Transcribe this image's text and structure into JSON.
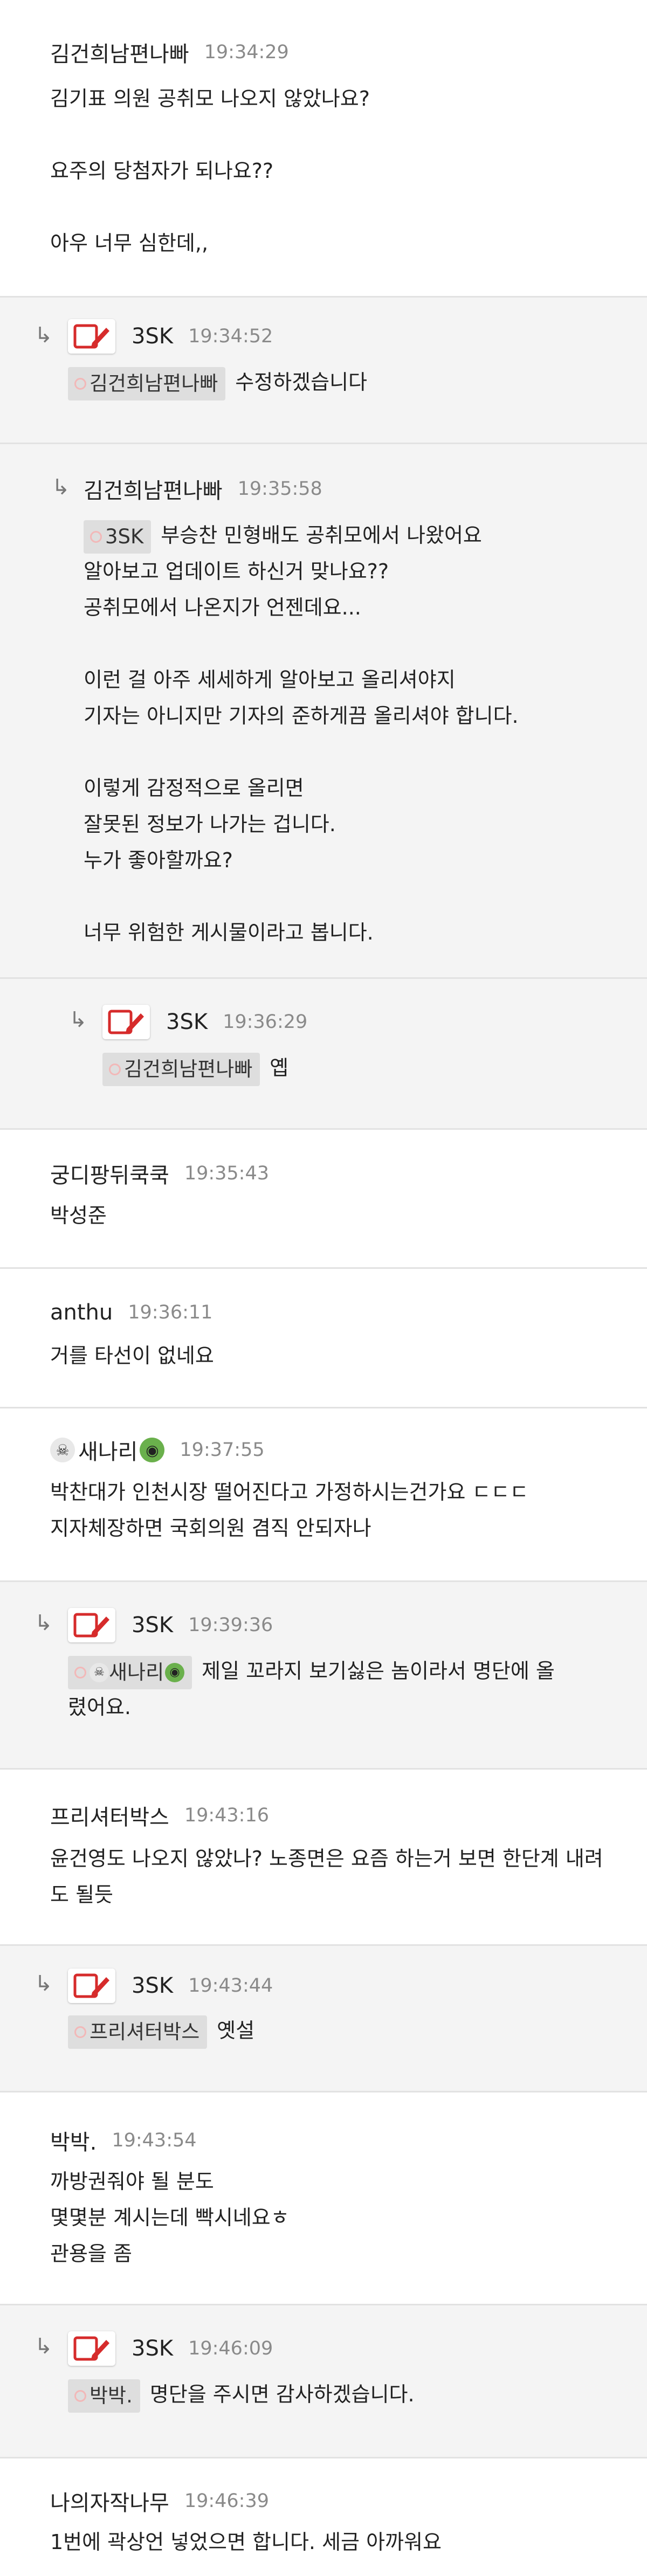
{
  "comments": [
    {
      "nick": "김건희남편나빠",
      "time": "19:34:29",
      "lines": [
        "김기표 의원 공취모 나오지 않았나요?",
        "",
        "요주의 당첨자가 되나요??",
        "",
        "아우 너무 심한데,,"
      ]
    },
    {
      "nick": "3SK",
      "time": "19:34:52",
      "mention": "김건희남편나빠",
      "text": "수정하겠습니다"
    },
    {
      "nick": "김건희남편나빠",
      "time": "19:35:58",
      "mention": "3SK",
      "lines": [
        "부승찬 민형배도 공취모에서 나왔어요",
        "알아보고 업데이트 하신거 맞나요??",
        "공취모에서 나온지가 언젠데요...",
        "",
        "이런 걸 아주 세세하게 알아보고 올리셔야지",
        "기자는 아니지만 기자의 준하게끔 올리셔야 합니다.",
        "",
        "이렇게 감정적으로 올리면",
        "잘못된 정보가 나가는 겁니다.",
        "누가 좋아할까요?",
        "",
        "너무 위험한 게시물이라고 봅니다."
      ]
    },
    {
      "nick": "3SK",
      "time": "19:36:29",
      "mention": "김건희남편나빠",
      "text": "옙"
    },
    {
      "nick": "궁디팡뒤쿡쿡",
      "time": "19:35:43",
      "lines": [
        "박성준"
      ]
    },
    {
      "nick": "anthu",
      "time": "19:36:11",
      "lines": [
        "거를 타선이 없네요"
      ]
    },
    {
      "nick": "새나리",
      "time": "19:37:55",
      "lines": [
        "박찬대가 인천시장 떨어진다고 가정하시는건가요 ㄷㄷㄷ",
        "지자체장하면 국회의원 겸직 안되자나"
      ]
    },
    {
      "nick": "3SK",
      "time": "19:39:36",
      "mention": "새나리",
      "text": "제일 꼬라지 보기싫은 놈이라서 명단에 올",
      "text2": "렸어요."
    },
    {
      "nick": "프리셔터박스",
      "time": "19:43:16",
      "lines": [
        "윤건영도 나오지 않았나? 노종면은 요즘 하는거 보면 한단계 내려",
        "도 될듯"
      ]
    },
    {
      "nick": "3SK",
      "time": "19:43:44",
      "mention": "프리셔터박스",
      "text": "옛설"
    },
    {
      "nick": "박박.",
      "time": "19:43:54",
      "lines": [
        "까방권줘야 될 분도",
        "몇몇분 계시는데 빡시네요ㅎ",
        "관용을 좀"
      ]
    },
    {
      "nick": "3SK",
      "time": "19:46:09",
      "mention": "박박.",
      "text": "명단을 주시면 감사하겠습니다."
    },
    {
      "nick": "나의자작나무",
      "time": "19:46:39",
      "lines": [
        "1번에 곽상언 넣었으면 합니다. 세금 아까워요"
      ]
    }
  ],
  "reply_arrow": "↳",
  "icons": {
    "badge": "pen-badge-icon",
    "skull": "skull-emoji-icon",
    "alien": "alien-emoji-icon"
  },
  "colors": {
    "reply_bg": "#f4f4f4",
    "divider": "#e2e2e2",
    "time": "#8a8a8a",
    "badge_red": "#d62b2b",
    "mention_bg": "#dedede"
  }
}
